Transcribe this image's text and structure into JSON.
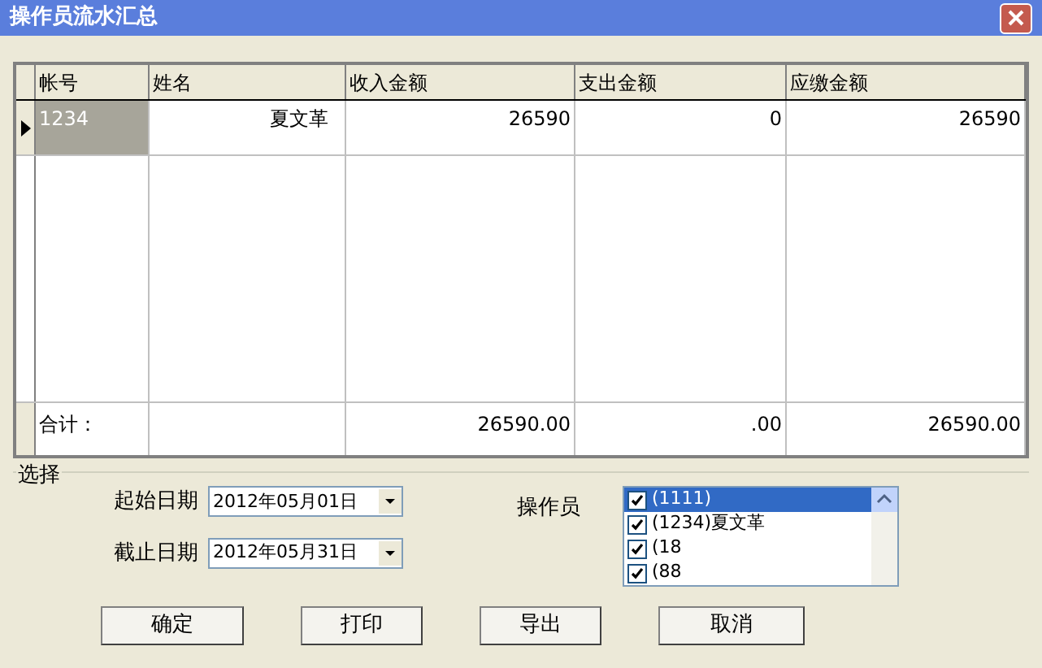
{
  "window": {
    "title": "操作员流水汇总"
  },
  "table": {
    "columns": [
      "帐号",
      "姓名",
      "收入金额",
      "支出金额",
      "应缴金额"
    ],
    "rows": [
      {
        "selected": true,
        "cells": [
          "1234",
          "夏文革",
          "26590",
          "0",
          "26590"
        ]
      }
    ],
    "total": {
      "label": "合计：",
      "values": [
        "26590.00",
        ".00",
        "26590.00"
      ]
    }
  },
  "filter": {
    "title": "选择",
    "start_label": "起始日期",
    "start_value": "2012年05月01日",
    "end_label": "截止日期",
    "end_value": "2012年05月31日",
    "operator_label": "操作员",
    "operators": [
      {
        "label": "(1111)",
        "checked": true,
        "selected": true
      },
      {
        "label": "(1234)夏文革",
        "checked": true,
        "selected": false
      },
      {
        "label": "(18",
        "checked": true,
        "selected": false
      },
      {
        "label": "(88",
        "checked": true,
        "selected": false
      }
    ]
  },
  "buttons": [
    "确定",
    "打印",
    "导出",
    "取消"
  ]
}
